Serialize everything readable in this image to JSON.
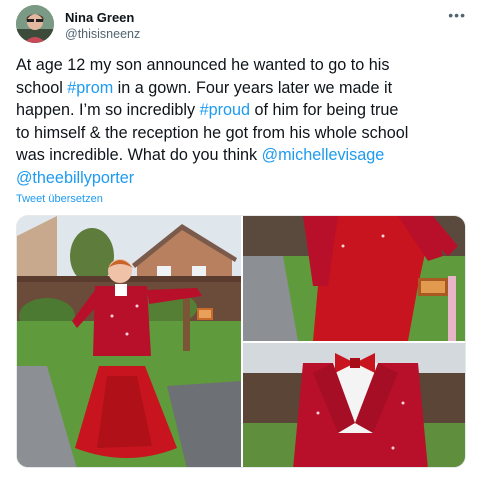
{
  "author": {
    "name": "Nina Green",
    "handle": "@thisisneenz"
  },
  "more_icon": "more-horizontal-icon",
  "tweet": {
    "line1": "At age 12 my son announced he wanted to go to his",
    "line2_a": "school ",
    "line2_tag": "#prom",
    "line2_b": " in a gown. Four years later we made it",
    "line3_a": "happen. I’m so incredibly ",
    "line3_tag": "#proud",
    "line3_b": " of him for being true",
    "line4": "to himself & the reception he got from his whole school",
    "line5_a": "was incredible. What do you think ",
    "line5_mention": "@michellevisage",
    "line6_mention": "@theebillyporter"
  },
  "translate_label": "Tweet übersetzen",
  "colors": {
    "link": "#1d9bf0",
    "gown_red": "#c8141e",
    "lawn_green": "#5f9b3c"
  }
}
